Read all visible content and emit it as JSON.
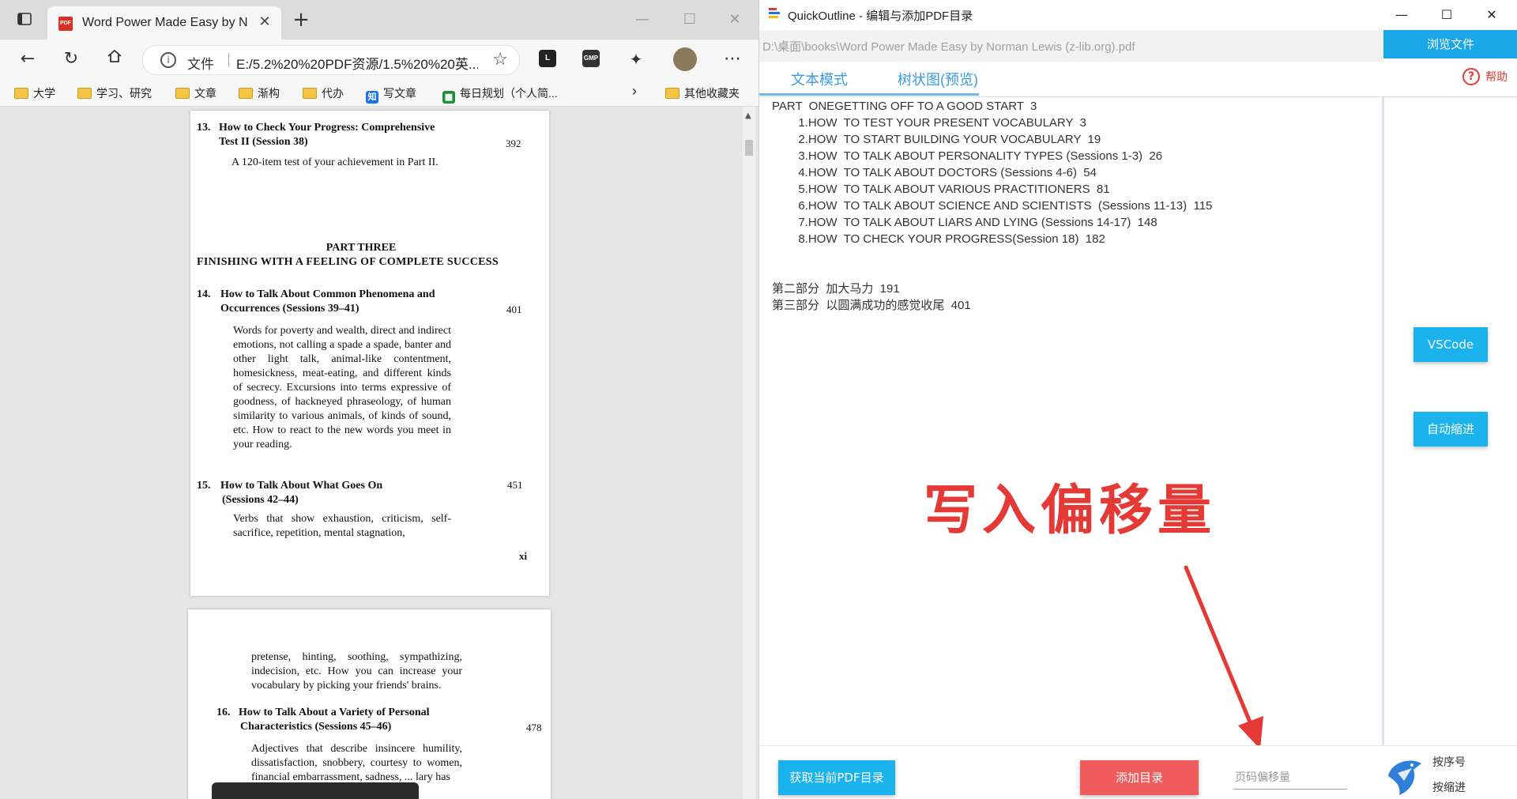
{
  "browser": {
    "tab_title": "Word Power Made Easy by Norm",
    "favicon_label": "PDF",
    "new_tab": "+",
    "address_prefix": "文件",
    "address_url": "E:/5.2%20%20PDF资源/1.5%20%20英...",
    "bookmarks": [
      "大学",
      "学习、研究",
      "文章",
      "渐构",
      "代办",
      "写文章",
      "每日规划（个人简...",
      "其他收藏夹"
    ],
    "ext_l": "L",
    "ext_gmp": "GMP"
  },
  "pdf": {
    "page1": {
      "e13_num": "13.",
      "e13_title": "How to Check Your Progress: Comprehensive",
      "e13_title2": "Test II (Session 38)",
      "e13_page": "392",
      "e13_desc": "A 120-item test of your achievement in Part II.",
      "part_heading": "PART THREE",
      "part_sub": "FINISHING WITH A FEELING OF COMPLETE SUCCESS",
      "e14_num": "14.",
      "e14_title": "How to Talk About Common Phenomena and",
      "e14_title2": "Occurrences (Sessions 39–41)",
      "e14_page": "401",
      "e14_desc": "Words for poverty and wealth, direct and indirect emotions, not calling a spade a spade, banter and other light talk, animal-like contentment, homesickness, meat-eating, and different kinds of secrecy. Excursions into terms expressive of goodness, of hackneyed phraseology, of human similarity to various animals, of kinds of sound, etc. How to react to the new words you meet in your reading.",
      "e15_num": "15.",
      "e15_title": "How to Talk About What Goes On",
      "e15_title2": "(Sessions 42–44)",
      "e15_page": "451",
      "e15_desc": "Verbs that show exhaustion, criticism, self-sacrifice, repetition, mental stagnation,",
      "roman": "xi"
    },
    "page2": {
      "cont": "pretense, hinting, soothing, sympathizing, indecision, etc. How you can increase your vocabulary by picking your friends' brains.",
      "e16_num": "16.",
      "e16_title": "How to Talk About a Variety of Personal",
      "e16_title2": "Characteristics (Sessions 45–46)",
      "e16_page": "478",
      "e16_desc": "Adjectives that describe insincere humility, dissatisfaction, snobbery, courtesy to women, financial embarrassment, sadness, ... lary has"
    }
  },
  "app": {
    "title": "QuickOutline - 编辑与添加PDF目录",
    "file_path": "D:\\桌面\\books\\Word Power Made Easy by Norman Lewis (z-lib.org).pdf",
    "browse_label": "浏览文件",
    "tab_text": "文本模式",
    "tab_tree": "树状图(预览)",
    "help_label": "帮助",
    "outline_lines": [
      "PART  ONEGETTING OFF TO A GOOD START  3",
      "        1.HOW  TO TEST YOUR PRESENT VOCABULARY  3",
      "        2.HOW  TO START BUILDING YOUR VOCABULARY  19",
      "        3.HOW  TO TALK ABOUT PERSONALITY TYPES (Sessions 1-3)  26",
      "        4.HOW  TO TALK ABOUT DOCTORS (Sessions 4-6)  54",
      "        5.HOW  TO TALK ABOUT VARIOUS PRACTITIONERS  81",
      "        6.HOW  TO TALK ABOUT SCIENCE AND SCIENTISTS  (Sessions 11-13)  115",
      "        7.HOW  TO TALK ABOUT LIARS AND LYING (Sessions 14-17)  148",
      "        8.HOW  TO CHECK YOUR PROGRESS(Session 18)  182",
      "",
      "",
      "第二部分  加大马力  191",
      "第三部分  以圆满成功的感觉收尾  401"
    ],
    "vscode_label": "VSCode",
    "auto_indent_label": "自动缩进",
    "annotation": "写入偏移量",
    "get_outline_label": "获取当前PDF目录",
    "add_outline_label": "添加目录",
    "offset_placeholder": "页码偏移量",
    "radio_by_number": "按序号",
    "radio_by_indent": "按缩进"
  },
  "colors": {
    "accent_blue": "#1ab3ee",
    "danger_red": "#f25b5b",
    "annotation_red": "#e53935"
  }
}
